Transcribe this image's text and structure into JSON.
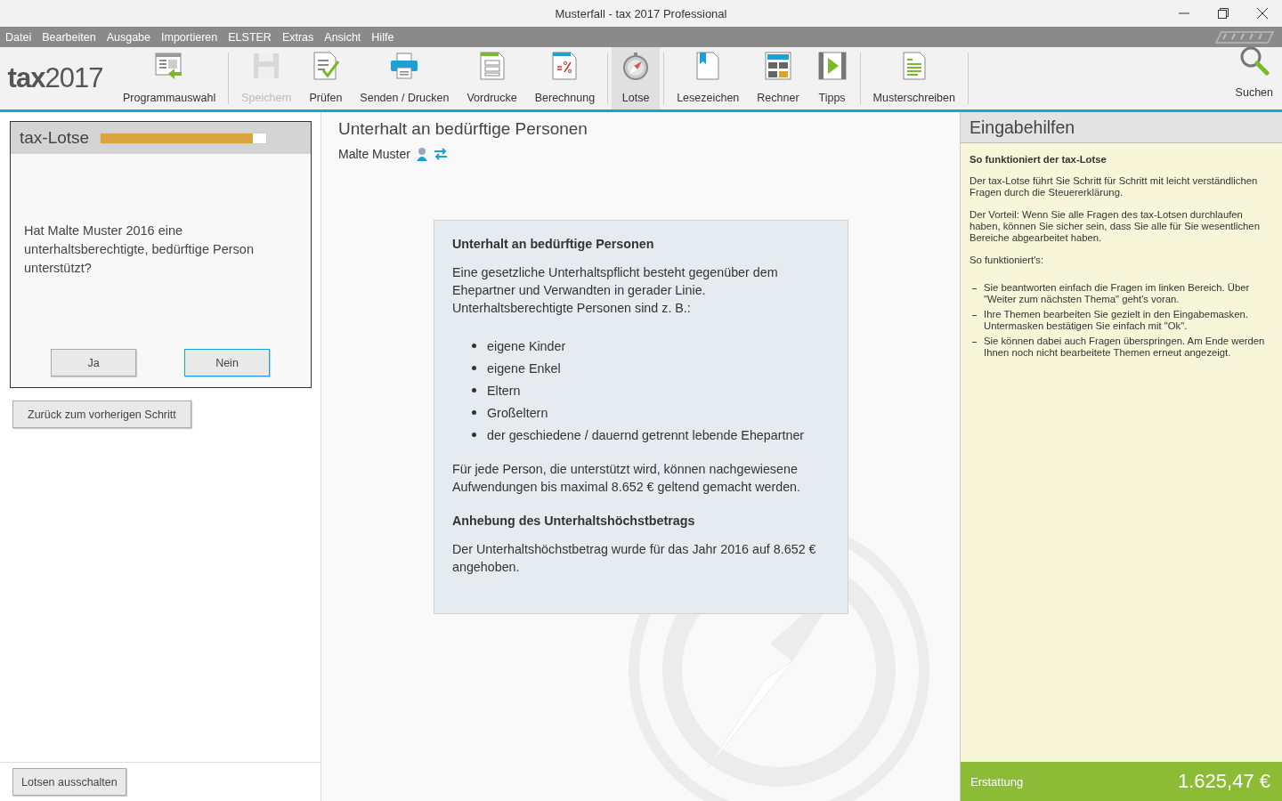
{
  "window": {
    "title": "Musterfall - tax 2017 Professional"
  },
  "menu": [
    {
      "label": "Datei"
    },
    {
      "label": "Bearbeiten"
    },
    {
      "label": "Ausgabe"
    },
    {
      "label": "Importieren"
    },
    {
      "label": "ELSTER"
    },
    {
      "label": "Extras"
    },
    {
      "label": "Ansicht"
    },
    {
      "label": "Hilfe"
    }
  ],
  "logo": {
    "word": "tax",
    "year": "2017"
  },
  "toolbar": {
    "groups": [
      [
        {
          "kind": "programs",
          "label": "Programmauswahl",
          "disabled": false,
          "selected": false
        }
      ],
      [
        {
          "kind": "save",
          "label": "Speichern",
          "disabled": true,
          "selected": false
        },
        {
          "kind": "check",
          "label": "Prüfen",
          "disabled": false,
          "selected": false
        },
        {
          "kind": "print",
          "label": "Senden / Drucken",
          "disabled": false,
          "selected": false
        },
        {
          "kind": "forms",
          "label": "Vordrucke",
          "disabled": false,
          "selected": false
        },
        {
          "kind": "calc",
          "label": "Berechnung",
          "disabled": false,
          "selected": false
        }
      ],
      [
        {
          "kind": "compass",
          "label": "Lotse",
          "disabled": false,
          "selected": true
        }
      ],
      [
        {
          "kind": "bookmark",
          "label": "Lesezeichen",
          "disabled": false,
          "selected": false
        },
        {
          "kind": "calculator",
          "label": "Rechner",
          "disabled": false,
          "selected": false
        },
        {
          "kind": "video",
          "label": "Tipps",
          "disabled": false,
          "selected": false
        }
      ],
      [
        {
          "kind": "letter",
          "label": "Musterschreiben",
          "disabled": false,
          "selected": false
        }
      ]
    ],
    "search": {
      "label": "Suchen"
    }
  },
  "lotse": {
    "title": "tax-Lotse",
    "level": 0.92,
    "question": "Hat Malte Muster 2016 eine unterhaltsberechtigte, bedürftige Person unterstützt?",
    "answers": [
      {
        "label": "Ja",
        "selected": false
      },
      {
        "label": "Nein",
        "selected": true
      }
    ],
    "back": "Zurück zum vorherigen Schritt",
    "off": "Lotsen ausschalten"
  },
  "content": {
    "heading": "Unterhalt an bedürftige Personen",
    "person": "Malte Muster",
    "info": {
      "title": "Unterhalt an bedürftige Personen",
      "intro": "Eine gesetzliche Unterhaltspflicht besteht gegenüber dem Ehepartner und Verwandten in gerader Linie. Unterhaltsberechtigte Personen sind z. B.:",
      "items": [
        "eigene Kinder",
        "eigene Enkel",
        "Eltern",
        "Großeltern",
        "der geschiedene / dauernd getrennt lebende Ehepartner"
      ],
      "note": "Für jede Person, die unterstützt wird, können nachgewiesene Aufwendungen bis maximal 8.652 € geltend gemacht werden.",
      "subtitle": "Anhebung des Unterhaltshöchstbetrags",
      "update": "Der Unterhaltshöchstbetrag wurde für das Jahr 2016 auf 8.652 € angehoben."
    }
  },
  "help": {
    "title": "Eingabehilfen",
    "heading": "So funktioniert der tax-Lotse",
    "paragraphs": [
      "Der tax-Lotse führt Sie Schritt für Schritt mit leicht verständlichen Fragen durch die Steuererklärung.",
      "Der Vorteil: Wenn Sie alle Fragen des tax-Lotsen durchlaufen haben, können Sie sicher sein, dass Sie alle für Sie wesentlichen Bereiche abgearbeitet haben.",
      "So funktioniert's:"
    ],
    "bullets": [
      "Sie beantworten einfach die Fragen im linken Bereich. Über \"Weiter zum nächsten Thema\" geht's voran.",
      "Ihre Themen bearbeiten Sie gezielt in den Eingabemasken. Untermasken bestätigen Sie einfach mit \"Ok\".",
      "Sie können dabei auch Fragen überspringen. Am Ende werden Ihnen noch nicht bearbeitete Themen erneut angezeigt."
    ]
  },
  "refund": {
    "label": "Erstattung",
    "amount": "1.625,47 €"
  }
}
